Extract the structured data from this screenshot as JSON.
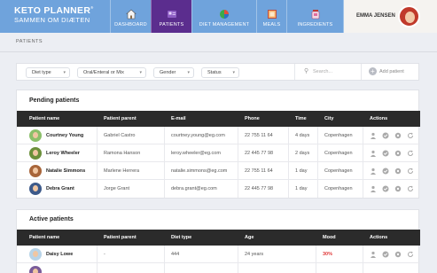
{
  "app": {
    "logo_line1": "KETO PLANNER",
    "logo_mark": "®",
    "logo_line2": "SAMMEN OM DIÆTEN"
  },
  "nav": {
    "items": [
      {
        "label": "DASHBOARD",
        "icon": "house-icon",
        "active": false
      },
      {
        "label": "PATIENTS",
        "icon": "patients-icon",
        "active": true
      },
      {
        "label": "DIET MANAGEMENT",
        "icon": "pie-chart-icon",
        "active": false
      },
      {
        "label": "MEALS",
        "icon": "meals-icon",
        "active": false
      },
      {
        "label": "INGREDIENTS",
        "icon": "ingredients-icon",
        "active": false
      }
    ],
    "active_color": "#5b2d8e",
    "bar_color": "#6fa3dc"
  },
  "user": {
    "name": "EMMA JENSEN"
  },
  "breadcrumb": {
    "label": "PATIENTS"
  },
  "filters": {
    "diet_type": "Diet type",
    "oral_enteral": "Oral/Enteral or Mix",
    "gender": "Gender",
    "status": "Status",
    "search_placeholder": "Search...",
    "add_patient": "Add patient"
  },
  "pending": {
    "title": "Pending patients",
    "columns": [
      "Patient name",
      "Patient parent",
      "E-mail",
      "Phone",
      "Time",
      "City",
      "Actions"
    ],
    "rows": [
      {
        "name": "Courtney Young",
        "parent": "Gabriel Castro",
        "email": "courtney.young@eg.com",
        "phone": "22 755 11 64",
        "time": "4 days",
        "city": "Copenhagen"
      },
      {
        "name": "Leroy Wheeler",
        "parent": "Ramona Hanson",
        "email": "leroy.wheeler@eg.com",
        "phone": "22 445 77 98",
        "time": "2 days",
        "city": "Copenhagen"
      },
      {
        "name": "Natalie Simmons",
        "parent": "Marlene Herrera",
        "email": "natalie.simmons@eg.com",
        "phone": "22 755 11 64",
        "time": "1 day",
        "city": "Copenhagen"
      },
      {
        "name": "Debra Grant",
        "parent": "Jorge Grant",
        "email": "debra.grant@eg.com",
        "phone": "22 445 77 98",
        "time": "1 day",
        "city": "Copenhagen"
      }
    ]
  },
  "active": {
    "title": "Active patients",
    "columns": [
      "Patient name",
      "Patient parent",
      "Diet type",
      "Age",
      "Mood",
      "Actions"
    ],
    "rows": [
      {
        "name": "Daisy Lowe",
        "parent": "-",
        "diet": "444",
        "age": "24 years",
        "mood": "30%"
      }
    ]
  }
}
